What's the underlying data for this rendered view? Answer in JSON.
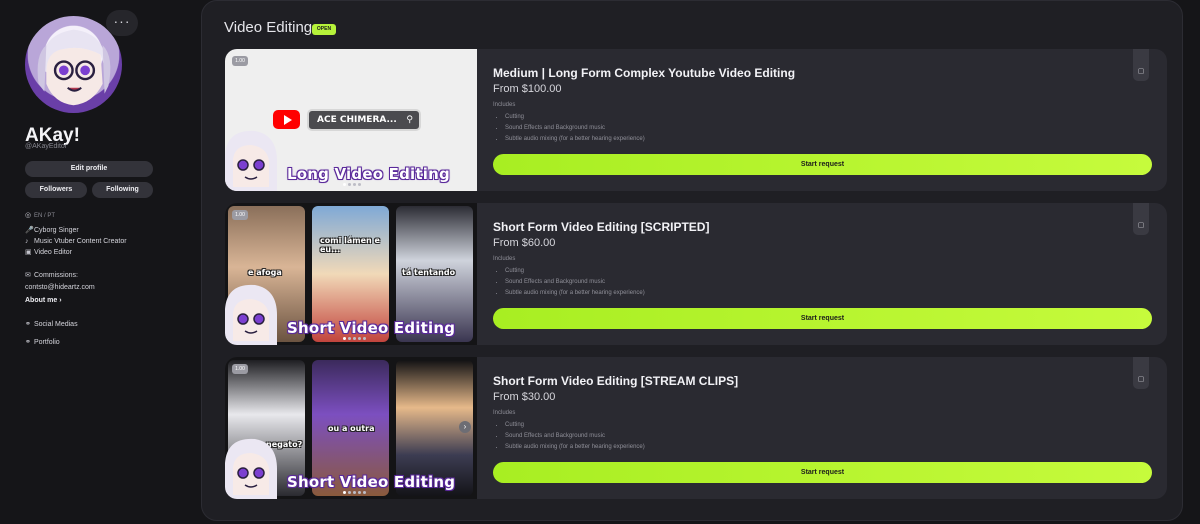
{
  "profile": {
    "more_label": "···",
    "name": "AKay!",
    "handle": "@AKayEditor",
    "edit_profile_label": "Edit profile",
    "followers_label": "Followers",
    "following_label": "Following",
    "languages": "EN / PT",
    "bio": [
      {
        "icon": "microphone-icon",
        "text": "Cyborg Singer"
      },
      {
        "icon": "music-note-icon",
        "text": "Music Vtuber Content Creator"
      },
      {
        "icon": "film-icon",
        "text": "Video Editor"
      }
    ],
    "commissions_label": "Commissions:",
    "commissions_email": "contsto@hideartz.com",
    "about_me_label": "About me",
    "links": [
      {
        "icon": "link-icon",
        "label": "Social Medias"
      },
      {
        "icon": "link-icon",
        "label": "Portfolio"
      }
    ]
  },
  "section": {
    "title": "Video Editing",
    "status_badge": "OPEN"
  },
  "services": [
    {
      "title": "Medium | Long Form Complex Youtube Video Editing",
      "price": "From $100.00",
      "includes_label": "Includes",
      "includes": [
        "Cutting",
        "Sound Effects and Background music",
        "Subtle audio mixing (for a better hearing experience)"
      ],
      "button_label": "Start request",
      "thumb_badge": "1.00",
      "thumb_caption": "Long Video Editing",
      "thumb_search_text": "ACE CHIMERA..."
    },
    {
      "title": "Short Form Video Editing [SCRIPTED]",
      "price": "From $60.00",
      "includes_label": "Includes",
      "includes": [
        "Cutting",
        "Sound Effects and Background music",
        "Subtle audio mixing (for a better hearing experience)"
      ],
      "button_label": "Start request",
      "thumb_badge": "1.00",
      "thumb_caption": "Short Video Editing",
      "panel_texts": [
        "e afoga",
        "comi lámen e eu...",
        "tá tentando"
      ]
    },
    {
      "title": "Short Form Video Editing [STREAM CLIPS]",
      "price": "From $30.00",
      "includes_label": "Includes",
      "includes": [
        "Cutting",
        "Sound Effects and Background music",
        "Subtle audio mixing (for a better hearing experience)"
      ],
      "button_label": "Start request",
      "thumb_badge": "1.00",
      "thumb_caption": "Short Video Editing",
      "panel_texts": [
        "negato?",
        "ou a outra",
        ""
      ]
    }
  ],
  "colors": {
    "accent": "#b6f23a",
    "background": "#151518",
    "panel": "#1f1f24",
    "card": "#2a2a31"
  }
}
